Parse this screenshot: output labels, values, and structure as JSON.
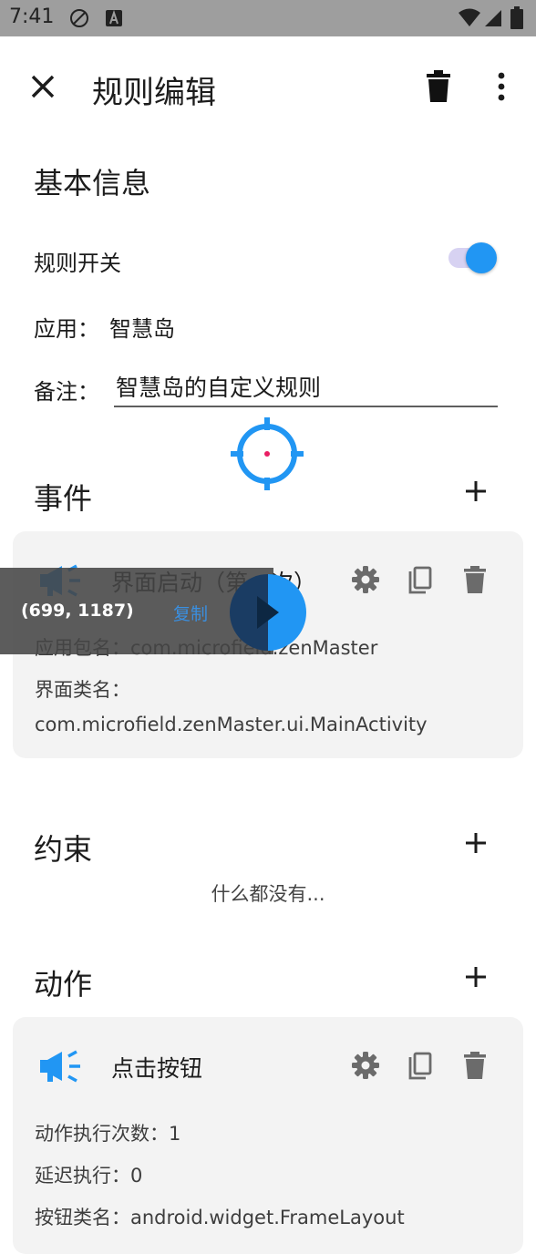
{
  "status_bar": {
    "time": "7:41",
    "icons": [
      "no-sync-icon",
      "a-notification-icon",
      "wifi-icon",
      "cellular-icon",
      "battery-icon"
    ]
  },
  "app_bar": {
    "title": "规则编辑",
    "close_icon": "close-icon",
    "delete_icon": "trash-icon",
    "more_icon": "more-vert-icon"
  },
  "basic_info": {
    "title": "基本信息",
    "switch_label": "规则开关",
    "switch_on": true,
    "app_label": "应用：",
    "app_value": "智慧岛",
    "remark_label": "备注：",
    "remark_value": "智慧岛的自定义规则"
  },
  "events": {
    "title": "事件",
    "card": {
      "title": "界面启动（第一次）",
      "package_label": "应用包名：",
      "package_value": "com.microfield.zenMaster",
      "activity_label": "界面类名：",
      "activity_value": "com.microfield.zenMaster.ui.MainActivity"
    }
  },
  "constraints": {
    "title": "约束",
    "empty": "什么都没有..."
  },
  "actions": {
    "title": "动作",
    "card": {
      "title": "点击按钮",
      "count_label": "动作执行次数：",
      "count_value": "1",
      "delay_label": "延迟执行：",
      "delay_value": "0",
      "class_label": "按钮类名：",
      "class_value": "android.widget.FrameLayout"
    }
  },
  "overlay": {
    "coords": "(699, 1187)",
    "copy": "复制"
  },
  "colors": {
    "accent": "#2196f3",
    "switch_track": "#d7d2f2",
    "card_bg": "#f3f3f3",
    "icon_gray": "#6b6b6b",
    "crosshair_dot": "#e91e63"
  }
}
